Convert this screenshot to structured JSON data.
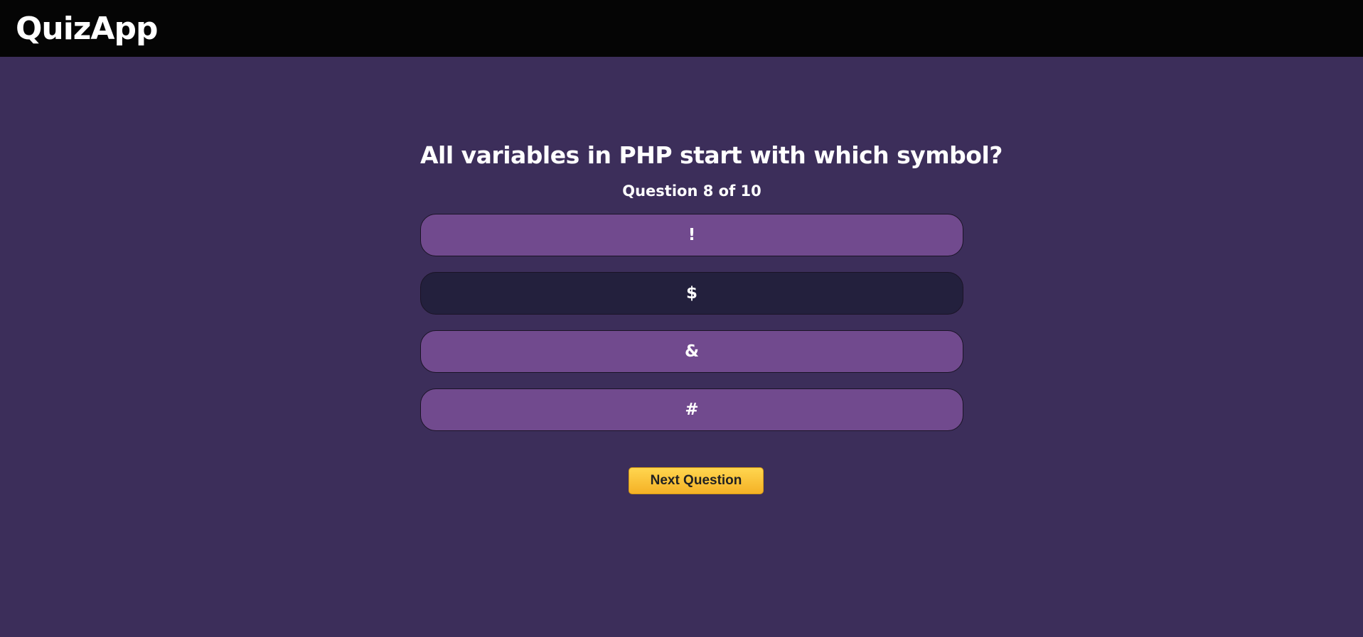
{
  "header": {
    "logo_text": "QuizApp"
  },
  "quiz": {
    "question": "All variables in PHP start with which symbol?",
    "counter": "Question 8 of 10",
    "answers": [
      {
        "label": "!",
        "selected": false
      },
      {
        "label": "$",
        "selected": true
      },
      {
        "label": "&",
        "selected": false
      },
      {
        "label": "#",
        "selected": false
      }
    ],
    "next_label": "Next Question"
  },
  "colors": {
    "page_background": "#3c2e5a",
    "topbar_background": "#050505",
    "answer_background": "#714a8e",
    "answer_selected_background": "#23203d",
    "next_button": "#fcc437"
  }
}
